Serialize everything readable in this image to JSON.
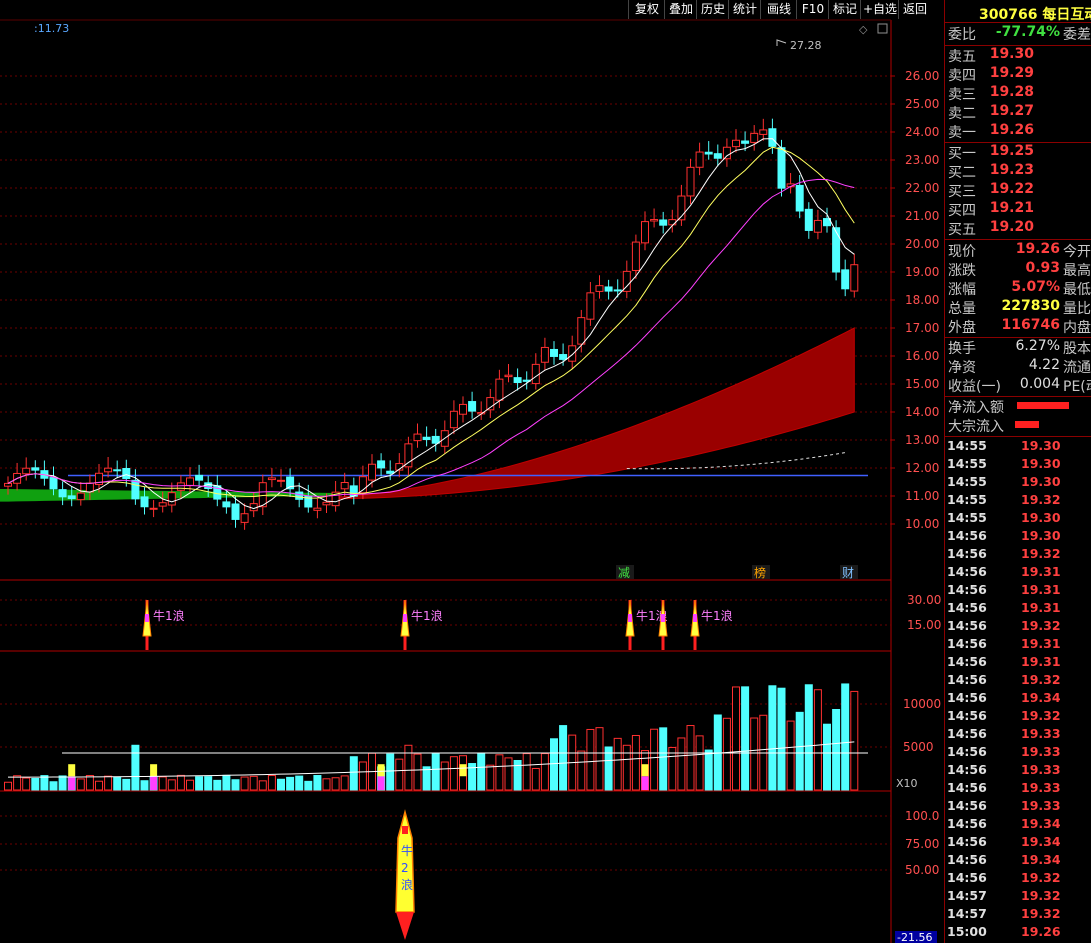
{
  "toolbar": {
    "buttons": [
      "复权",
      "叠加",
      "历史",
      "统计",
      "画线",
      "F10",
      "标记",
      "+自选",
      "返回"
    ]
  },
  "chart": {
    "price_label": ":11.73",
    "peak_label": "27.28",
    "price_axis": [
      "26.00",
      "25.00",
      "24.00",
      "23.00",
      "22.00",
      "21.00",
      "20.00",
      "19.00",
      "18.00",
      "17.00",
      "16.00",
      "15.00",
      "14.00",
      "13.00",
      "12.00",
      "11.00",
      "10.00"
    ],
    "markers": [
      {
        "text": "减",
        "color": "#40e040"
      },
      {
        "text": "榜",
        "color": "#ffa500"
      },
      {
        "text": "财",
        "color": "#80c0ff"
      }
    ],
    "sub1_axis": [
      "30.00",
      "15.00"
    ],
    "signal_text": "牛1浪",
    "vol_axis": [
      "10000",
      "5000"
    ],
    "vol_unit": "X10",
    "sub3_axis": [
      "100.0",
      "75.00",
      "50.00"
    ],
    "sub3_value": "-21.56",
    "rocket_text": [
      "牛",
      "2",
      "浪"
    ]
  },
  "panel": {
    "code": "300766",
    "name": "每日互动",
    "weibi_label": "委比",
    "weibi_value": "-77.74%",
    "weicha_label": "委差",
    "sell": [
      {
        "label": "卖五",
        "price": "19.30"
      },
      {
        "label": "卖四",
        "price": "19.29"
      },
      {
        "label": "卖三",
        "price": "19.28"
      },
      {
        "label": "卖二",
        "price": "19.27"
      },
      {
        "label": "卖一",
        "price": "19.26"
      }
    ],
    "buy": [
      {
        "label": "买一",
        "price": "19.25"
      },
      {
        "label": "买二",
        "price": "19.23"
      },
      {
        "label": "买三",
        "price": "19.22"
      },
      {
        "label": "买四",
        "price": "19.21"
      },
      {
        "label": "买五",
        "price": "19.20"
      }
    ],
    "quote": [
      {
        "label": "现价",
        "value": "19.26",
        "label2": "今开",
        "color": "#ff4040"
      },
      {
        "label": "涨跌",
        "value": "0.93",
        "label2": "最高",
        "color": "#ff4040"
      },
      {
        "label": "涨幅",
        "value": "5.07%",
        "label2": "最低",
        "color": "#ff4040"
      },
      {
        "label": "总量",
        "value": "227830",
        "label2": "量比",
        "color": "#ffff40"
      },
      {
        "label": "外盘",
        "value": "116746",
        "label2": "内盘",
        "color": "#ff4040"
      }
    ],
    "quote2": [
      {
        "label": "换手",
        "value": "6.27%",
        "label2": "股本",
        "color": "#e0e0e0"
      },
      {
        "label": "净资",
        "value": "4.22",
        "label2": "流通",
        "color": "#e0e0e0"
      },
      {
        "label": "收益(一)",
        "value": "0.004",
        "label2": "PE(动",
        "color": "#e0e0e0"
      }
    ],
    "flow": [
      {
        "label": "净流入额"
      },
      {
        "label": "大宗流入"
      }
    ],
    "ticks": [
      {
        "t": "14:55",
        "p": "19.30"
      },
      {
        "t": "14:55",
        "p": "19.30"
      },
      {
        "t": "14:55",
        "p": "19.30"
      },
      {
        "t": "14:55",
        "p": "19.32"
      },
      {
        "t": "14:55",
        "p": "19.30"
      },
      {
        "t": "14:56",
        "p": "19.30"
      },
      {
        "t": "14:56",
        "p": "19.32"
      },
      {
        "t": "14:56",
        "p": "19.31"
      },
      {
        "t": "14:56",
        "p": "19.31"
      },
      {
        "t": "14:56",
        "p": "19.31"
      },
      {
        "t": "14:56",
        "p": "19.32"
      },
      {
        "t": "14:56",
        "p": "19.31"
      },
      {
        "t": "14:56",
        "p": "19.31"
      },
      {
        "t": "14:56",
        "p": "19.32"
      },
      {
        "t": "14:56",
        "p": "19.34"
      },
      {
        "t": "14:56",
        "p": "19.32"
      },
      {
        "t": "14:56",
        "p": "19.33"
      },
      {
        "t": "14:56",
        "p": "19.33"
      },
      {
        "t": "14:56",
        "p": "19.33"
      },
      {
        "t": "14:56",
        "p": "19.33"
      },
      {
        "t": "14:56",
        "p": "19.33"
      },
      {
        "t": "14:56",
        "p": "19.34"
      },
      {
        "t": "14:56",
        "p": "19.34"
      },
      {
        "t": "14:56",
        "p": "19.34"
      },
      {
        "t": "14:56",
        "p": "19.32"
      },
      {
        "t": "14:57",
        "p": "19.32"
      },
      {
        "t": "14:57",
        "p": "19.32"
      },
      {
        "t": "15:00",
        "p": "19.26"
      }
    ]
  }
}
